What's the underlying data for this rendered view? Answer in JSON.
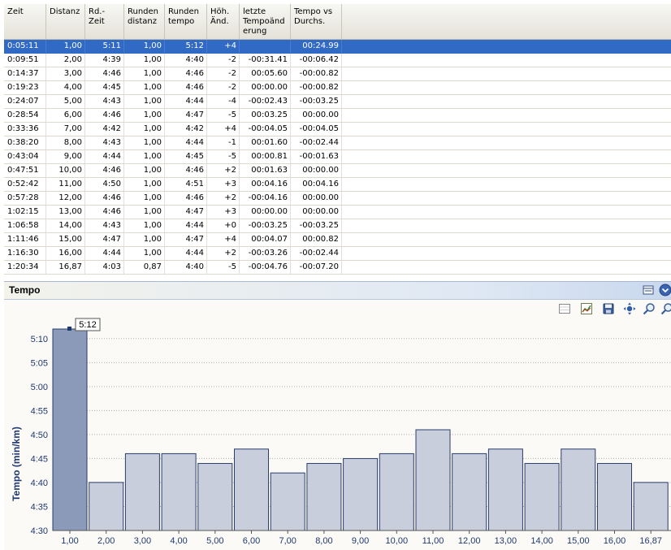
{
  "table": {
    "columns": [
      {
        "key": "zeit",
        "label": "Zeit"
      },
      {
        "key": "distanz",
        "label": "Distanz"
      },
      {
        "key": "rd_zeit",
        "label": "Rd.-\nZeit"
      },
      {
        "key": "runden_distanz",
        "label": "Runden\ndistanz"
      },
      {
        "key": "runden_tempo",
        "label": "Runden\ntempo"
      },
      {
        "key": "hoeh",
        "label": "Höh.\nÄnd."
      },
      {
        "key": "letzte",
        "label": "letzte\nTempoänd\nerung"
      },
      {
        "key": "tempo_vs",
        "label": "Tempo vs\nDurchs."
      }
    ],
    "selected_row": 0,
    "rows": [
      [
        "0:05:11",
        "1,00",
        "5:11",
        "1,00",
        "5:12",
        "+4",
        "",
        "00:24.99"
      ],
      [
        "0:09:51",
        "2,00",
        "4:39",
        "1,00",
        "4:40",
        "-2",
        "-00:31.41",
        "-00:06.42"
      ],
      [
        "0:14:37",
        "3,00",
        "4:46",
        "1,00",
        "4:46",
        "-2",
        "00:05.60",
        "-00:00.82"
      ],
      [
        "0:19:23",
        "4,00",
        "4:45",
        "1,00",
        "4:46",
        "-2",
        "00:00.00",
        "-00:00.82"
      ],
      [
        "0:24:07",
        "5,00",
        "4:43",
        "1,00",
        "4:44",
        "-4",
        "-00:02.43",
        "-00:03.25"
      ],
      [
        "0:28:54",
        "6,00",
        "4:46",
        "1,00",
        "4:47",
        "-5",
        "00:03.25",
        "00:00.00"
      ],
      [
        "0:33:36",
        "7,00",
        "4:42",
        "1,00",
        "4:42",
        "+4",
        "-00:04.05",
        "-00:04.05"
      ],
      [
        "0:38:20",
        "8,00",
        "4:43",
        "1,00",
        "4:44",
        "-1",
        "00:01.60",
        "-00:02.44"
      ],
      [
        "0:43:04",
        "9,00",
        "4:44",
        "1,00",
        "4:45",
        "-5",
        "00:00.81",
        "-00:01.63"
      ],
      [
        "0:47:51",
        "10,00",
        "4:46",
        "1,00",
        "4:46",
        "+2",
        "00:01.63",
        "00:00.00"
      ],
      [
        "0:52:42",
        "11,00",
        "4:50",
        "1,00",
        "4:51",
        "+3",
        "00:04.16",
        "00:04.16"
      ],
      [
        "0:57:28",
        "12,00",
        "4:46",
        "1,00",
        "4:46",
        "+2",
        "-00:04.16",
        "00:00.00"
      ],
      [
        "1:02:15",
        "13,00",
        "4:46",
        "1,00",
        "4:47",
        "+3",
        "00:00.00",
        "00:00.00"
      ],
      [
        "1:06:58",
        "14,00",
        "4:43",
        "1,00",
        "4:44",
        "+0",
        "-00:03.25",
        "-00:03.25"
      ],
      [
        "1:11:46",
        "15,00",
        "4:47",
        "1,00",
        "4:47",
        "+4",
        "00:04.07",
        "00:00.82"
      ],
      [
        "1:16:30",
        "16,00",
        "4:44",
        "1,00",
        "4:44",
        "+2",
        "-00:03.26",
        "-00:02.44"
      ],
      [
        "1:20:34",
        "16,87",
        "4:03",
        "0,87",
        "4:40",
        "-5",
        "-00:04.76",
        "-00:07.20"
      ]
    ]
  },
  "panel": {
    "title": "Tempo",
    "icons": [
      "collapse-icon",
      "dropdown-icon",
      "grid-icon",
      "chart-settings-icon",
      "save-icon",
      "pan-icon",
      "zoom-in-icon",
      "zoom-out-icon"
    ]
  },
  "chart_data": {
    "type": "bar",
    "title": "",
    "xlabel": "",
    "ylabel": "Tempo (min/km)",
    "categories": [
      "1,00",
      "2,00",
      "3,00",
      "4,00",
      "5,00",
      "6,00",
      "7,00",
      "8,00",
      "9,00",
      "10,00",
      "11,00",
      "12,00",
      "13,00",
      "14,00",
      "15,00",
      "16,00",
      "16,87"
    ],
    "values_min_per_km": [
      5.2,
      4.667,
      4.767,
      4.767,
      4.733,
      4.783,
      4.7,
      4.733,
      4.75,
      4.767,
      4.85,
      4.767,
      4.783,
      4.733,
      4.783,
      4.733,
      4.667
    ],
    "ylim_min_per_km": [
      4.5,
      5.2
    ],
    "yticks_min_per_km": [
      4.5,
      4.5833,
      4.6667,
      4.75,
      4.8333,
      4.9167,
      5.0,
      5.0833,
      5.1667
    ],
    "ytick_labels": [
      "4:30",
      "4:35",
      "4:40",
      "4:45",
      "4:50",
      "4:55",
      "5:00",
      "5:05",
      "5:10"
    ],
    "grid": true,
    "highlighted_index": 0,
    "tooltip": "5:12",
    "colors": {
      "bar": "#c9cedc",
      "bar_selected": "#8a9ab8",
      "bar_edge": "#2a3d6b",
      "axis_label": "#1f3870",
      "grid": "#b0b0b0"
    }
  }
}
